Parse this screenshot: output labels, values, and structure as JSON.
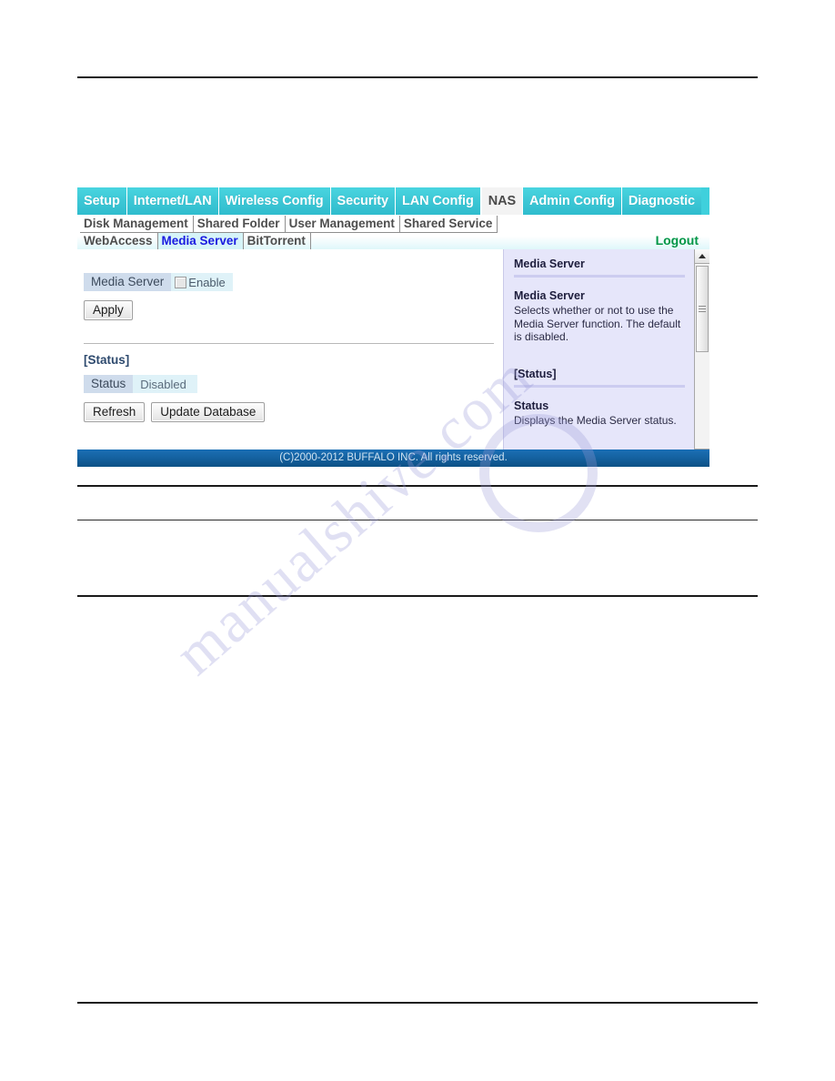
{
  "main_tabs": [
    {
      "label": "Setup",
      "active": false
    },
    {
      "label": "Internet/LAN",
      "active": false
    },
    {
      "label": "Wireless Config",
      "active": false
    },
    {
      "label": "Security",
      "active": false
    },
    {
      "label": "LAN Config",
      "active": false
    },
    {
      "label": "NAS",
      "active": true
    },
    {
      "label": "Admin Config",
      "active": false
    },
    {
      "label": "Diagnostic",
      "active": false
    }
  ],
  "sub_tabs_row1": [
    {
      "label": "Disk Management",
      "selected": false
    },
    {
      "label": "Shared Folder",
      "selected": false
    },
    {
      "label": "User Management",
      "selected": false
    },
    {
      "label": "Shared Service",
      "selected": false
    }
  ],
  "sub_tabs_row2": [
    {
      "label": "WebAccess",
      "selected": false
    },
    {
      "label": "Media Server",
      "selected": true
    },
    {
      "label": "BitTorrent",
      "selected": false
    }
  ],
  "logout_label": "Logout",
  "form": {
    "media_server_label": "Media Server",
    "enable_label": "Enable",
    "enable_checked": false,
    "apply_label": "Apply"
  },
  "status_section": {
    "heading": "[Status]",
    "status_label": "Status",
    "status_value": "Disabled",
    "refresh_label": "Refresh",
    "update_db_label": "Update Database"
  },
  "help": {
    "title": "Media Server",
    "sub1_title": "Media Server",
    "sub1_text": "Selects whether or not to use the Media Server function. The default is disabled.",
    "section2_title": "[Status]",
    "sub2_title": "Status",
    "sub2_text": "Displays the Media Server status."
  },
  "footer": {
    "copyright": "(C)2000-2012 BUFFALO INC. All rights reserved."
  },
  "watermark": {
    "text": "manualshive.com"
  },
  "colors": {
    "tab_cyan": "#3fd0dc",
    "selected_subtab_text": "#1a1ae0",
    "logout_green": "#009646",
    "footer_blue": "#14619f",
    "help_panel": "#e6e6fa"
  }
}
